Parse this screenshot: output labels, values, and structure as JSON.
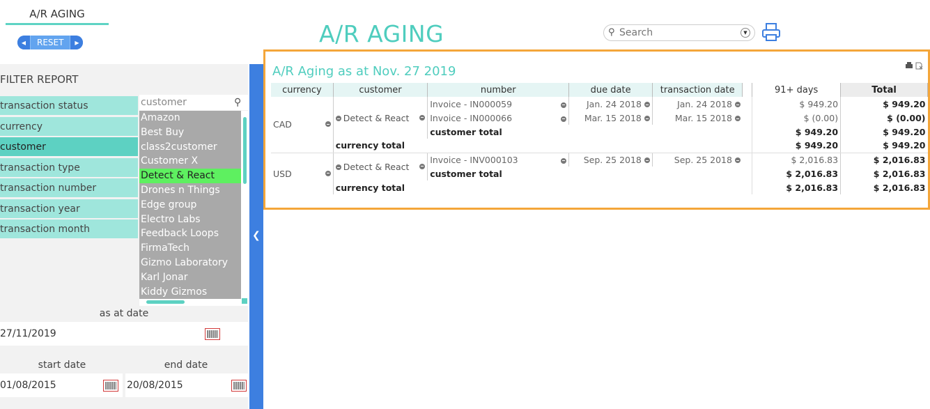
{
  "tab": {
    "label": "A/R AGING"
  },
  "reset_label": "RESET",
  "header": {
    "title": "A/R AGING",
    "search_placeholder": "Search"
  },
  "filter": {
    "title": "FILTER REPORT",
    "items": [
      "transaction status",
      "currency",
      "customer",
      "transaction type",
      "transaction number",
      "transaction year",
      "transaction month"
    ],
    "active_index": 2,
    "customer_search_value": "customer",
    "customers": [
      "Amazon",
      "Best Buy",
      "class2customer",
      "Customer X",
      "Detect & React",
      "Drones n Things",
      "Edge group",
      "Electro Labs",
      "Feedback Loops",
      "FirmaTech",
      "Gizmo Laboratory",
      "Karl Jonar",
      "Kiddy Gizmos"
    ],
    "selected_customer": "Detect & React",
    "as_at_label": "as at date",
    "as_at_value": "27/11/2019",
    "start_label": "start date",
    "start_value": "01/08/2015",
    "end_label": "end date",
    "end_value": "20/08/2015"
  },
  "report": {
    "title": "A/R Aging as at Nov. 27 2019",
    "columns": [
      "currency",
      "customer",
      "number",
      "due date",
      "transaction date",
      "91+ days",
      "Total"
    ],
    "cad": {
      "currency": "CAD",
      "customer": "Detect & React",
      "rows": [
        {
          "number": "Invoice - IN000059",
          "due": "Jan. 24 2018",
          "txn": "Jan. 24 2018",
          "d91": "$ 949.20",
          "total": "$ 949.20"
        },
        {
          "number": "Invoice - IN000066",
          "due": "Mar. 15 2018",
          "txn": "Mar. 15 2018",
          "d91": "$ (0.00)",
          "total": "$ (0.00)"
        }
      ],
      "customer_total_label": "customer total",
      "customer_total_d91": "$ 949.20",
      "customer_total": "$ 949.20",
      "currency_total_label": "currency total",
      "currency_total_d91": "$ 949.20",
      "currency_total": "$ 949.20"
    },
    "usd": {
      "currency": "USD",
      "customer": "Detect & React",
      "rows": [
        {
          "number": "Invoice - INV000103",
          "due": "Sep. 25 2018",
          "txn": "Sep. 25 2018",
          "d91": "$ 2,016.83",
          "total": "$ 2,016.83"
        }
      ],
      "customer_total_label": "customer total",
      "customer_total_d91": "$ 2,016.83",
      "customer_total": "$ 2,016.83",
      "currency_total_label": "currency total",
      "currency_total_d91": "$ 2,016.83",
      "currency_total": "$ 2,016.83"
    }
  },
  "colors": {
    "accent": "#4fcdbe",
    "blue": "#3d7fe0",
    "highlight": "#f4a63a",
    "selected": "#5ef060"
  }
}
